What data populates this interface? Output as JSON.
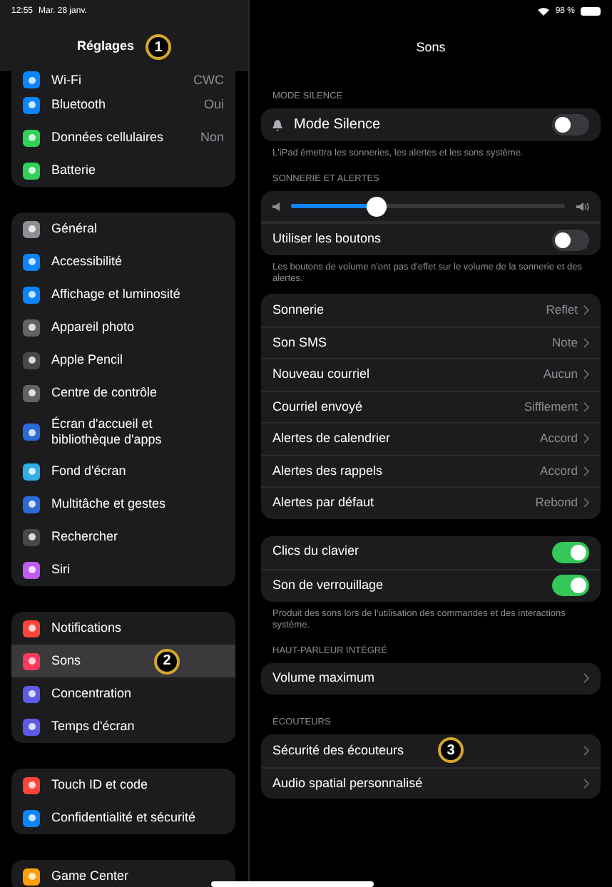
{
  "status_bar": {
    "time": "12:55",
    "date": "Mar. 28 janv.",
    "battery": "98 %"
  },
  "sidebar": {
    "title": "Réglages",
    "badge": "1",
    "groups": [
      {
        "items": [
          {
            "label": "Wi-Fi",
            "value": "CWC",
            "color": "#0a84ff",
            "partial": true,
            "selected": false
          },
          {
            "label": "Bluetooth",
            "value": "Oui",
            "color": "#0a84ff",
            "selected": false
          },
          {
            "label": "Données cellulaires",
            "value": "Non",
            "color": "#30d158",
            "selected": false
          },
          {
            "label": "Batterie",
            "color": "#30d158",
            "selected": false
          }
        ]
      },
      {
        "items": [
          {
            "label": "Général",
            "color": "#8e8e93",
            "selected": false
          },
          {
            "label": "Accessibilité",
            "color": "#0a84ff",
            "selected": false
          },
          {
            "label": "Affichage et luminosité",
            "color": "#0a84ff",
            "selected": false
          },
          {
            "label": "Appareil photo",
            "color": "#636366",
            "selected": false
          },
          {
            "label": "Apple Pencil",
            "color": "#48484a",
            "selected": false
          },
          {
            "label": "Centre de contrôle",
            "color": "#636366",
            "selected": false
          },
          {
            "label": "Écran d'accueil et bibliothèque d'apps",
            "color": "#2c6bd6",
            "selected": false
          },
          {
            "label": "Fond d'écran",
            "color": "#32ade6",
            "selected": false
          },
          {
            "label": "Multitâche et gestes",
            "color": "#2c6bd6",
            "selected": false
          },
          {
            "label": "Rechercher",
            "color": "#48484a",
            "selected": false
          },
          {
            "label": "Siri",
            "color": "#bf5af2",
            "selected": false
          }
        ]
      },
      {
        "items": [
          {
            "label": "Notifications",
            "color": "#ff453a",
            "selected": false
          },
          {
            "label": "Sons",
            "color": "#ff375f",
            "selected": true,
            "badge": "2"
          },
          {
            "label": "Concentration",
            "color": "#5e5ce6",
            "selected": false
          },
          {
            "label": "Temps d'écran",
            "color": "#5e5ce6",
            "selected": false
          }
        ]
      },
      {
        "items": [
          {
            "label": "Touch ID et code",
            "color": "#ff453a",
            "selected": false
          },
          {
            "label": "Confidentialité et sécurité",
            "color": "#0a84ff",
            "selected": false
          }
        ]
      },
      {
        "items": [
          {
            "label": "Game Center",
            "color": "#ff9f0a",
            "selected": false
          }
        ]
      }
    ]
  },
  "detail": {
    "title": "Sons",
    "sections": [
      {
        "header": "MODE SILENCE",
        "rows": [
          {
            "kind": "toggle",
            "label": "Mode Silence",
            "icon": true,
            "on": false
          }
        ],
        "footer": "L'iPad émettra les sonneries, les alertes et les sons système."
      },
      {
        "header": "SONNERIE ET ALERTES",
        "rows": [
          {
            "kind": "slider",
            "level": 0.31
          },
          {
            "kind": "toggle",
            "label": "Utiliser les boutons",
            "on": false
          }
        ],
        "footer": "Les boutons de volume n'ont pas d'effet sur le volume de la sonnerie et des alertes."
      },
      {
        "rows": [
          {
            "kind": "link",
            "label": "Sonnerie",
            "value": "Reflet"
          },
          {
            "kind": "link",
            "label": "Son SMS",
            "value": "Note"
          },
          {
            "kind": "link",
            "label": "Nouveau courriel",
            "value": "Aucun"
          },
          {
            "kind": "link",
            "label": "Courriel envoyé",
            "value": "Sifflement"
          },
          {
            "kind": "link",
            "label": "Alertes de calendrier",
            "value": "Accord"
          },
          {
            "kind": "link",
            "label": "Alertes des rappels",
            "value": "Accord"
          },
          {
            "kind": "link",
            "label": "Alertes par défaut",
            "value": "Rebond"
          }
        ]
      },
      {
        "rows": [
          {
            "kind": "toggle",
            "label": "Clics du clavier",
            "on": true
          },
          {
            "kind": "toggle",
            "label": "Son de verrouillage",
            "on": true
          }
        ],
        "footer": "Produit des sons lors de l'utilisation des commandes et des interactions système."
      },
      {
        "header": "HAUT-PARLEUR INTÉGRÉ",
        "rows": [
          {
            "kind": "link",
            "label": "Volume maximum"
          }
        ]
      },
      {
        "header": "ÉCOUTEURS",
        "rows": [
          {
            "kind": "link",
            "label": "Sécurité des écouteurs",
            "badge": "3"
          },
          {
            "kind": "link",
            "label": "Audio spatial personnalisé"
          }
        ]
      }
    ]
  }
}
